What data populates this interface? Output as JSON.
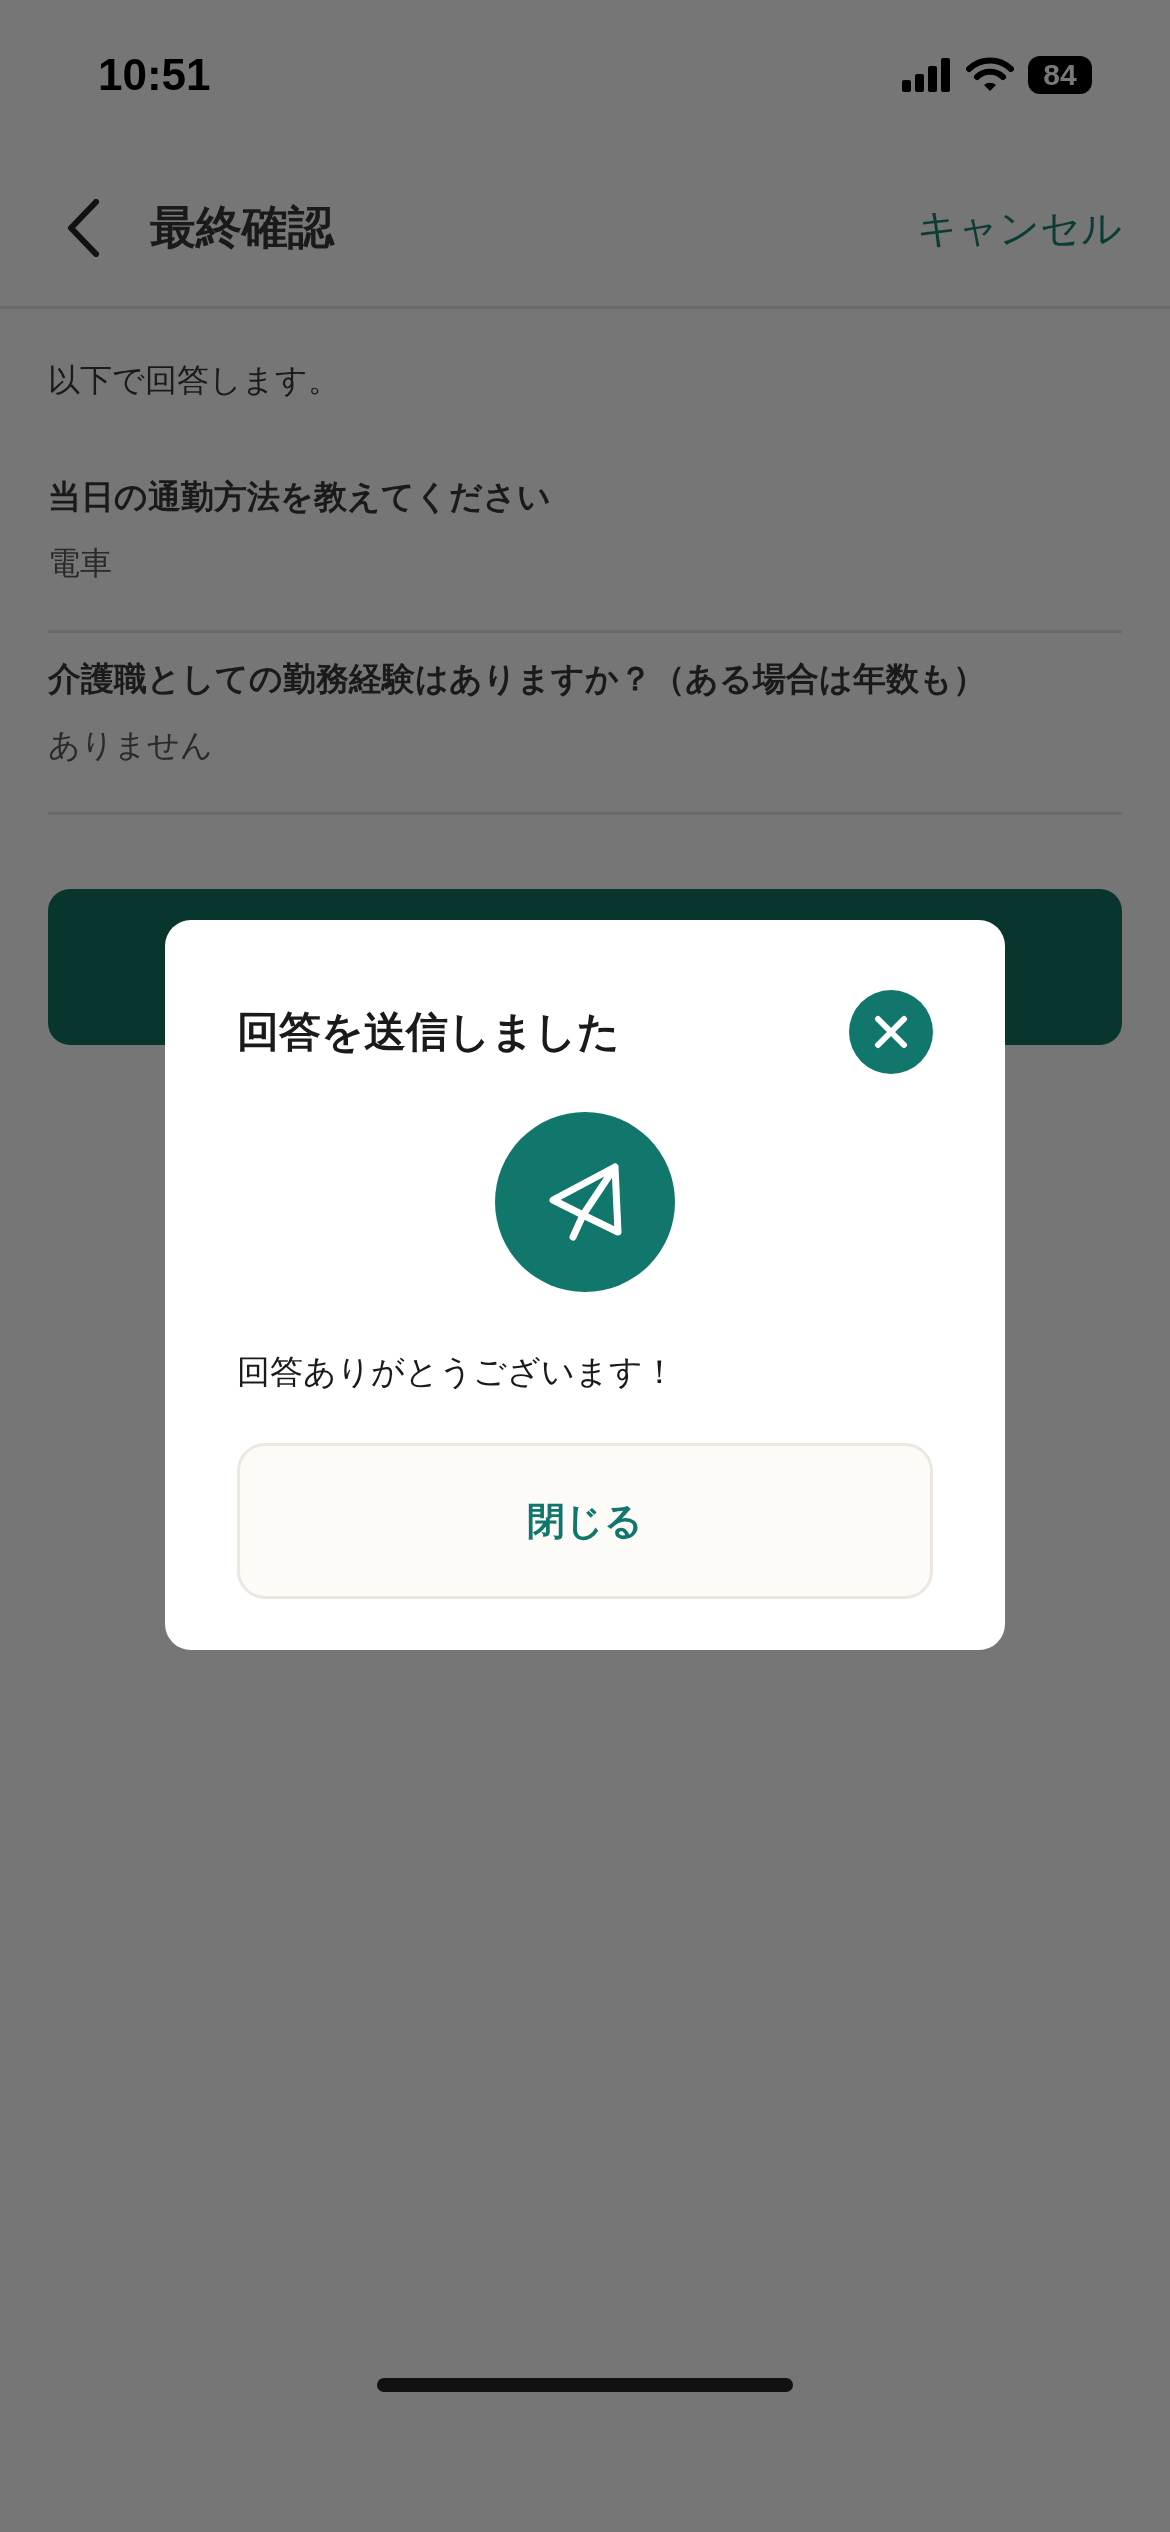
{
  "status_bar": {
    "time": "10:51",
    "battery": "84"
  },
  "nav": {
    "title": "最終確認",
    "cancel": "キャンセル"
  },
  "intro": "以下で回答します。",
  "answers": [
    {
      "question": "当日の通勤方法を教えてください",
      "answer": "電車"
    },
    {
      "question": "介護職としての勤務経験はありますか？（ある場合は年数も）",
      "answer": "ありません"
    }
  ],
  "dialog": {
    "title": "回答を送信しました",
    "message": "回答ありがとうございます！",
    "close_button": "閉じる"
  }
}
